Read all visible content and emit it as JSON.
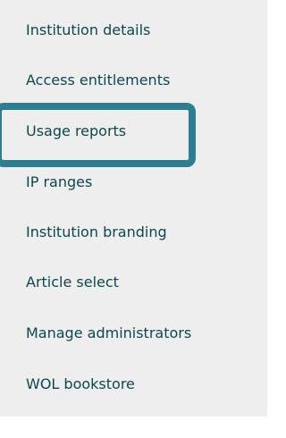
{
  "sidebar": {
    "items": [
      {
        "label": "Institution details"
      },
      {
        "label": "Access entitlements"
      },
      {
        "label": "Usage reports"
      },
      {
        "label": "IP ranges"
      },
      {
        "label": "Institution branding"
      },
      {
        "label": "Article select"
      },
      {
        "label": "Manage administrators"
      },
      {
        "label": "WOL bookstore"
      }
    ],
    "selected": "Usage reports"
  },
  "colors": {
    "panel_background": "#eeeeee",
    "text": "#0e4750",
    "highlight_border": "#2d7f90"
  }
}
